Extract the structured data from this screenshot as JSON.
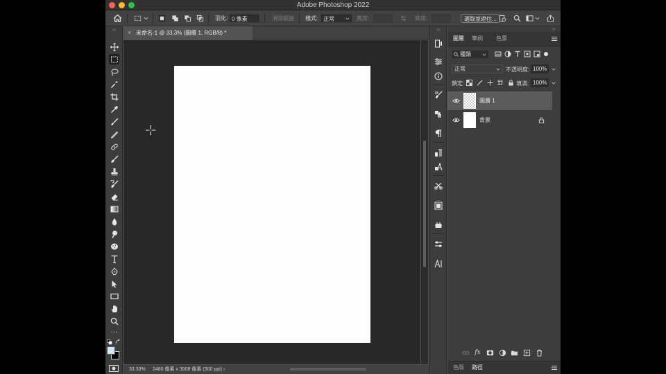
{
  "window": {
    "title": "Adobe Photoshop 2022"
  },
  "options_bar": {
    "feather_label": "羽化:",
    "feather_value": "0 像素",
    "antialias_label": "消除鋸齒",
    "style_label": "樣式:",
    "style_value": "正常",
    "width_label": "寬度:",
    "height_label": "高度:",
    "select_subject_label": "選取並遮住..."
  },
  "document_tab": {
    "title": "未命名-1 @ 33.3% (圖層 1, RGB/8) *",
    "close_glyph": "×"
  },
  "status_bar": {
    "zoom": "33.33%",
    "doc_info": "2480 像素 x 3508 像素 (300 ppi)",
    "arrow": "›"
  },
  "panels": {
    "tabs": [
      "圖層",
      "筆刷",
      "色票"
    ],
    "filter_label": "種類",
    "blend_mode": "正常",
    "opacity_label": "不透明度:",
    "opacity_value": "100%",
    "lock_label": "鎖定:",
    "fill_label": "填滿:",
    "fill_value": "100%",
    "layers": [
      {
        "name": "圖層 1",
        "selected": true,
        "visible": true,
        "locked": false
      },
      {
        "name": "背景",
        "selected": false,
        "visible": true,
        "locked": true
      }
    ],
    "bottom_tabs": [
      "色版",
      "路徑"
    ]
  },
  "colors": {
    "foreground": "#cfe7f3",
    "background": "#000000"
  },
  "tools": [
    "move-icon",
    "marquee-icon",
    "lasso-icon",
    "magic-wand-icon",
    "crop-icon",
    "eyedropper-icon",
    "brush-icon",
    "pencil-icon",
    "clone-stamp-icon",
    "healing-icon",
    "stamp-icon",
    "history-brush-icon",
    "eraser-icon",
    "gradient-icon",
    "blur-icon",
    "dodge-icon",
    "sponge-icon",
    "type-icon",
    "pen-icon",
    "path-select-icon",
    "rectangle-icon",
    "hand-icon",
    "zoom-icon",
    "more-icon"
  ]
}
